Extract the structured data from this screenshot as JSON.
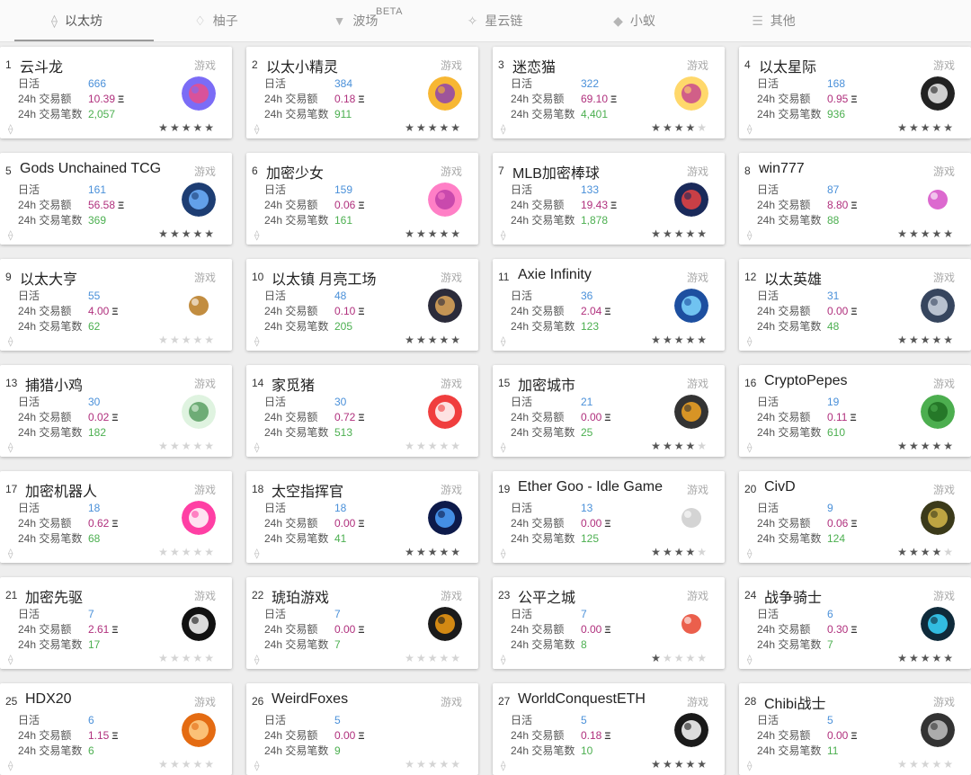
{
  "tabs": [
    {
      "label": "以太坊",
      "icon": "ethereum-icon",
      "glyph": "⟠",
      "active": true
    },
    {
      "label": "柚子",
      "icon": "eos-icon",
      "glyph": "♢",
      "active": false
    },
    {
      "label": "波场",
      "icon": "tron-icon",
      "glyph": "▼",
      "active": false,
      "badge": "BETA"
    },
    {
      "label": "星云链",
      "icon": "nebulas-icon",
      "glyph": "✧",
      "active": false
    },
    {
      "label": "小蚁",
      "icon": "neo-icon",
      "glyph": "◆",
      "active": false
    },
    {
      "label": "其他",
      "icon": "menu-icon",
      "glyph": "☰",
      "active": false
    }
  ],
  "labels": {
    "dau": "日活",
    "volume": "24h 交易额",
    "tx": "24h 交易笔数",
    "eth_symbol": "Ξ"
  },
  "cards": [
    {
      "rank": "1",
      "name": "云斗龙",
      "category": "游戏",
      "dau": "666",
      "volume": "10.39",
      "tx": "2,057",
      "stars": 5,
      "logo": "yundoulong-logo",
      "colors": [
        "#7b6cf6",
        "#e94e8a"
      ]
    },
    {
      "rank": "2",
      "name": "以太小精灵",
      "category": "游戏",
      "dau": "384",
      "volume": "0.18",
      "tx": "911",
      "stars": 5,
      "logo": "etherelves-logo",
      "colors": [
        "#f7b733",
        "#8e44ad"
      ]
    },
    {
      "rank": "3",
      "name": "迷恋猫",
      "category": "游戏",
      "dau": "322",
      "volume": "69.10",
      "tx": "4,401",
      "stars": 3.5,
      "logo": "cryptokitties-logo",
      "colors": [
        "#ffd86b",
        "#c94a8d"
      ]
    },
    {
      "rank": "4",
      "name": "以太星际",
      "category": "游戏",
      "dau": "168",
      "volume": "0.95",
      "tx": "936",
      "stars": 5,
      "logo": "etherstar-logo",
      "colors": [
        "#222222",
        "#eeeeee"
      ]
    },
    {
      "rank": "5",
      "name": "Gods Unchained TCG",
      "category": "游戏",
      "dau": "161",
      "volume": "56.58",
      "tx": "369",
      "stars": 5,
      "logo": "godsunchained-logo",
      "colors": [
        "#1d3d73",
        "#6fb1ff"
      ]
    },
    {
      "rank": "6",
      "name": "加密少女",
      "category": "游戏",
      "dau": "159",
      "volume": "0.06",
      "tx": "161",
      "stars": 5,
      "logo": "cryptogirl-logo",
      "colors": [
        "#ff7fc6",
        "#c03fa8"
      ]
    },
    {
      "rank": "7",
      "name": "MLB加密棒球",
      "category": "游戏",
      "dau": "133",
      "volume": "19.43",
      "tx": "1,878",
      "stars": 5,
      "logo": "mlbcrypto-logo",
      "colors": [
        "#1a2a5a",
        "#e94343"
      ]
    },
    {
      "rank": "8",
      "name": "win777",
      "category": "游戏",
      "dau": "87",
      "volume": "8.80",
      "tx": "88",
      "stars": 5,
      "logo": "win777-logo",
      "colors": [
        "#ffffff",
        "#d64fc7"
      ]
    },
    {
      "rank": "9",
      "name": "以太大亨",
      "category": "游戏",
      "dau": "55",
      "volume": "4.00",
      "tx": "62",
      "stars": 0,
      "logo": "ethertycoon-logo",
      "colors": [
        "#ffffff",
        "#b7791f"
      ]
    },
    {
      "rank": "10",
      "name": "以太镇 月亮工场",
      "category": "游戏",
      "dau": "48",
      "volume": "0.10",
      "tx": "205",
      "stars": 5,
      "logo": "ethertown-logo",
      "colors": [
        "#2b2b3a",
        "#e0a85a"
      ]
    },
    {
      "rank": "11",
      "name": "Axie Infinity",
      "category": "游戏",
      "dau": "36",
      "volume": "2.04",
      "tx": "123",
      "stars": 5,
      "logo": "axie-logo",
      "colors": [
        "#1d4fa0",
        "#7fd7ff"
      ]
    },
    {
      "rank": "12",
      "name": "以太英雄",
      "category": "游戏",
      "dau": "31",
      "volume": "0.00",
      "tx": "48",
      "stars": 5,
      "logo": "etherhero-logo",
      "colors": [
        "#36455e",
        "#cfd7e3"
      ]
    },
    {
      "rank": "13",
      "name": "捕猎小鸡",
      "category": "游戏",
      "dau": "30",
      "volume": "0.02",
      "tx": "182",
      "stars": 0,
      "logo": "chickenhunt-logo",
      "colors": [
        "#dff3e0",
        "#5a9f63"
      ]
    },
    {
      "rank": "14",
      "name": "家觅猪",
      "category": "游戏",
      "dau": "30",
      "volume": "0.72",
      "tx": "513",
      "stars": 0,
      "logo": "jiamizhu-logo",
      "colors": [
        "#f03e3e",
        "#ffffff"
      ]
    },
    {
      "rank": "15",
      "name": "加密城市",
      "category": "游戏",
      "dau": "21",
      "volume": "0.00",
      "tx": "25",
      "stars": 4,
      "logo": "cryptocity-logo",
      "colors": [
        "#333333",
        "#f5a623"
      ]
    },
    {
      "rank": "16",
      "name": "CryptoPepes",
      "category": "游戏",
      "dau": "19",
      "volume": "0.11",
      "tx": "610",
      "stars": 5,
      "logo": "cryptopepes-logo",
      "colors": [
        "#4cae4f",
        "#1e6e21"
      ]
    },
    {
      "rank": "17",
      "name": "加密机器人",
      "category": "游戏",
      "dau": "18",
      "volume": "0.62",
      "tx": "68",
      "stars": 0,
      "logo": "cryptobot-logo",
      "colors": [
        "#ff3fa4",
        "#ffffff"
      ]
    },
    {
      "rank": "18",
      "name": "太空指挥官",
      "category": "游戏",
      "dau": "18",
      "volume": "0.00",
      "tx": "41",
      "stars": 5,
      "logo": "spacecommander-logo",
      "colors": [
        "#0d1a4a",
        "#4fa3ff"
      ]
    },
    {
      "rank": "19",
      "name": "Ether Goo - Idle Game",
      "category": "游戏",
      "dau": "13",
      "volume": "0.00",
      "tx": "125",
      "stars": 4,
      "logo": "ethergoo-logo",
      "colors": [
        "#ffffff",
        "#cccccc"
      ]
    },
    {
      "rank": "20",
      "name": "CivD",
      "category": "游戏",
      "dau": "9",
      "volume": "0.06",
      "tx": "124",
      "stars": 4,
      "logo": "civd-logo",
      "colors": [
        "#3b3a1a",
        "#d6b84a"
      ]
    },
    {
      "rank": "21",
      "name": "加密先驱",
      "category": "游戏",
      "dau": "7",
      "volume": "2.61",
      "tx": "17",
      "stars": 0,
      "logo": "cryptopioneers-logo",
      "colors": [
        "#111111",
        "#ffffff"
      ]
    },
    {
      "rank": "22",
      "name": "琥珀游戏",
      "category": "游戏",
      "dau": "7",
      "volume": "0.00",
      "tx": "7",
      "stars": 0,
      "logo": "amber-logo",
      "colors": [
        "#1b1b1b",
        "#f39c12"
      ]
    },
    {
      "rank": "23",
      "name": "公平之城",
      "category": "游戏",
      "dau": "7",
      "volume": "0.00",
      "tx": "8",
      "stars": 1,
      "logo": "fairtown-logo",
      "colors": [
        "#ffffff",
        "#e8432d"
      ]
    },
    {
      "rank": "24",
      "name": "战争骑士",
      "category": "游戏",
      "dau": "6",
      "volume": "0.30",
      "tx": "7",
      "stars": 5,
      "logo": "warknights-logo",
      "colors": [
        "#0f2a3a",
        "#38d6ff"
      ]
    },
    {
      "rank": "25",
      "name": "HDX20",
      "category": "游戏",
      "dau": "6",
      "volume": "1.15",
      "tx": "6",
      "stars": 0,
      "logo": "hdx20-logo",
      "colors": [
        "#e46b12",
        "#ffd08a"
      ]
    },
    {
      "rank": "26",
      "name": "WeirdFoxes",
      "category": "游戏",
      "dau": "5",
      "volume": "0.00",
      "tx": "9",
      "stars": 0,
      "logo": "weirdfoxes-logo",
      "colors": [
        "#ffffff",
        "#ffffff"
      ]
    },
    {
      "rank": "27",
      "name": "WorldConquestETH",
      "category": "游戏",
      "dau": "5",
      "volume": "0.18",
      "tx": "10",
      "stars": 5,
      "logo": "worldconquest-logo",
      "colors": [
        "#1a1a1a",
        "#ffffff"
      ]
    },
    {
      "rank": "28",
      "name": "Chibi战士",
      "category": "游戏",
      "dau": "5",
      "volume": "0.00",
      "tx": "11",
      "stars": 0,
      "logo": "chibifighters-logo",
      "colors": [
        "#333333",
        "#c2c2c2"
      ]
    }
  ]
}
